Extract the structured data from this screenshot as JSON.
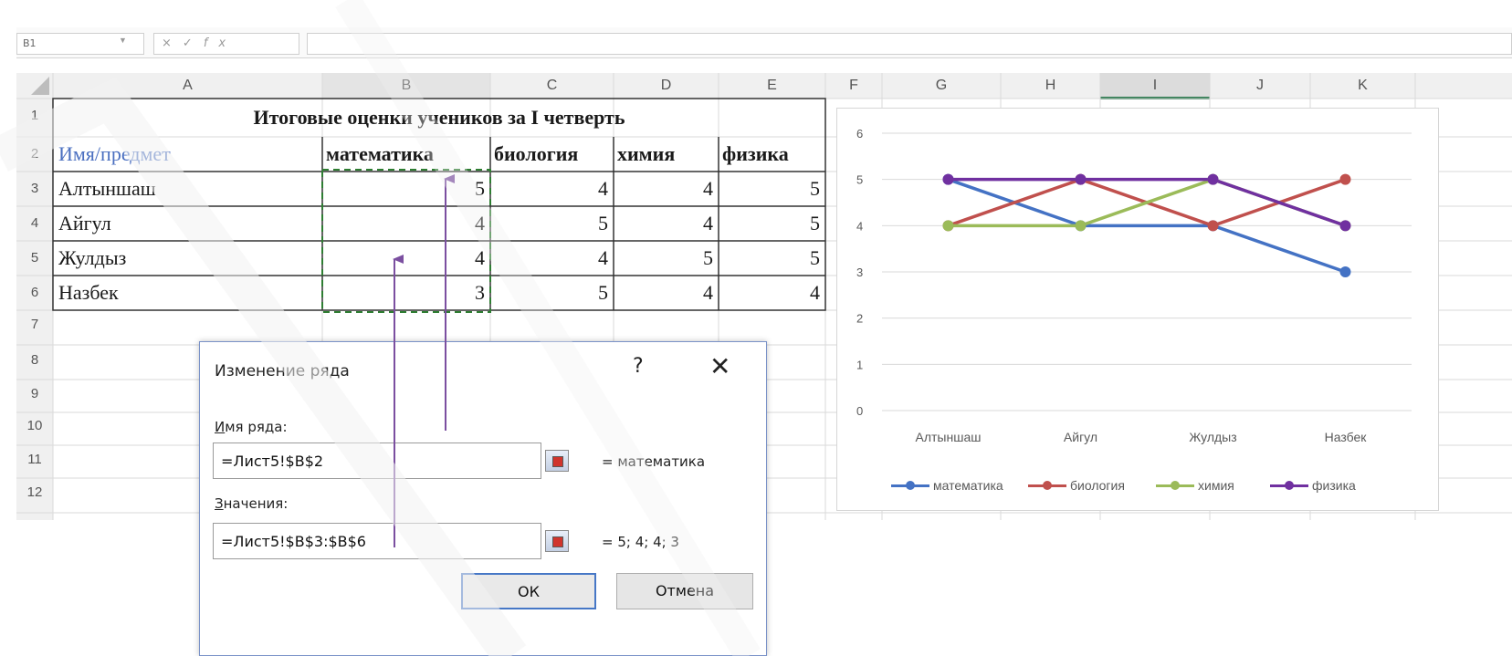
{
  "formula_bar": {
    "name_box": "B1",
    "buttons": [
      "×",
      "✓",
      "fx"
    ],
    "formula": ""
  },
  "sheet": {
    "columns": [
      "A",
      "B",
      "C",
      "D",
      "E",
      "F",
      "G",
      "H",
      "I",
      "J",
      "K"
    ],
    "rows": [
      "1",
      "2",
      "3",
      "4",
      "5",
      "6",
      "7",
      "8",
      "9",
      "10",
      "11",
      "12"
    ],
    "title": "Итоговые оценки учеников за  I четверть",
    "headers": [
      "Имя/предмет",
      "математика",
      "биология",
      "химия",
      "физика"
    ],
    "data": [
      {
        "name": "Алтыншаш",
        "values": [
          "5",
          "4",
          "4",
          "5"
        ]
      },
      {
        "name": "Айгул",
        "values": [
          "4",
          "5",
          "4",
          "5"
        ]
      },
      {
        "name": "Жулдыз",
        "values": [
          "4",
          "4",
          "5",
          "5"
        ]
      },
      {
        "name": "Назбек",
        "values": [
          "3",
          "5",
          "4",
          "4"
        ]
      }
    ]
  },
  "dialog": {
    "title": "Изменение ряда",
    "help": "?",
    "close": "✕",
    "series_name_label_underlined": "И",
    "series_name_label_rest": "мя ряда:",
    "series_name_value": "=Лист5!$B$2",
    "series_name_preview": "= математика",
    "values_label_underlined": "З",
    "values_label_rest": "начения:",
    "values_value": "=Лист5!$B$3:$B$6",
    "values_preview": "= 5; 4; 4; 3",
    "ok": "ОК",
    "cancel": "Отмена"
  },
  "colors": {
    "math": "#4472c4",
    "bio": "#c0504d",
    "chem": "#9bbb59",
    "phys": "#7030a0",
    "arrow": "#7b4fa0"
  },
  "chart_data": {
    "type": "line",
    "categories": [
      "Алтыншаш",
      "Айгул",
      "Жулдыз",
      "Назбек"
    ],
    "series": [
      {
        "name": "математика",
        "values": [
          5,
          4,
          4,
          3
        ],
        "color": "#4472c4"
      },
      {
        "name": "биология",
        "values": [
          4,
          5,
          4,
          5
        ],
        "color": "#c0504d"
      },
      {
        "name": "химия",
        "values": [
          4,
          4,
          5,
          4
        ],
        "color": "#9bbb59"
      },
      {
        "name": "физика",
        "values": [
          5,
          5,
          5,
          4
        ],
        "color": "#7030a0"
      }
    ],
    "ylim": [
      0,
      6
    ],
    "yticks": [
      "0",
      "1",
      "2",
      "3",
      "4",
      "5",
      "6"
    ],
    "grid": true,
    "legend_position": "bottom"
  }
}
